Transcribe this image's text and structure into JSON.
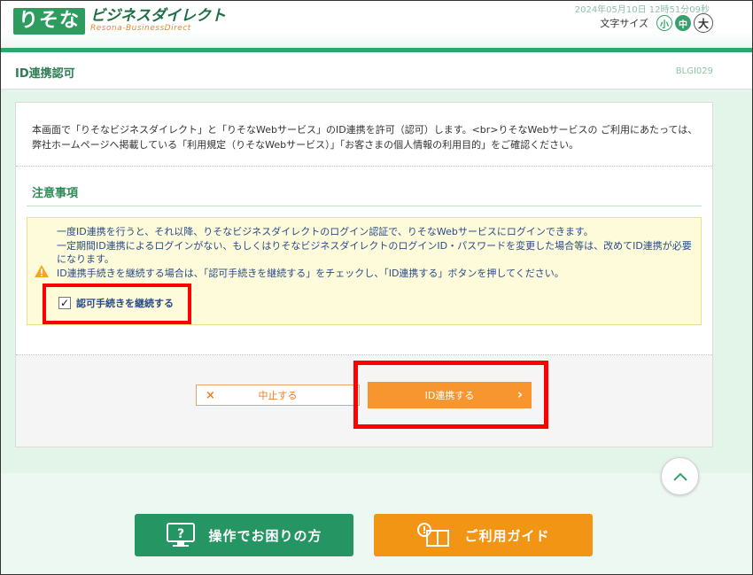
{
  "header": {
    "logo_main": "りそな",
    "logo_brand": "ビジネスダイレクト",
    "logo_sub": "Resona-BusinessDirect",
    "datetime": "2024年05月10日 12時51分09秒",
    "font_size_label": "文字サイズ",
    "font_sizes": [
      "小",
      "中",
      "大"
    ]
  },
  "titlebar": {
    "title": "ID連携認可",
    "screen_id": "BLGI029"
  },
  "intro": "本画面で「りそなビジネスダイレクト」と「りそなWebサービス」のID連携を許可（認可）します。<br>りそなWebサービスの ご利用にあたっては、弊社ホームページへ掲載している「利用規定（りそなWebサービス）」「お客さまの個人情報の利用目的」をご確認ください。",
  "notice": {
    "title": "注意事項",
    "lines": [
      "一度ID連携を行うと、それ以降、りそなビジネスダイレクトのログイン認証で、りそなWebサービスにログインできます。",
      "一定期間ID連携によるログインがない、もしくはりそなビジネスダイレクトのログインID・パスワードを変更した場合等は、改めてID連携が必要になります。",
      "ID連携手続きを継続する場合は、「認可手続きを継続する」をチェックし、「ID連携する」ボタンを押してください。"
    ],
    "checkbox_label": "認可手続きを継続する",
    "checked": true
  },
  "buttons": {
    "cancel": "中止する",
    "cancel_icon": "×",
    "confirm": "ID連携する",
    "confirm_icon": "›"
  },
  "footer": {
    "help": "操作でお困りの方",
    "guide": "ご利用ガイド"
  },
  "colors": {
    "brand_green": "#2e9c5f",
    "accent_orange": "#f7952f",
    "highlight_red": "#ff0000"
  }
}
